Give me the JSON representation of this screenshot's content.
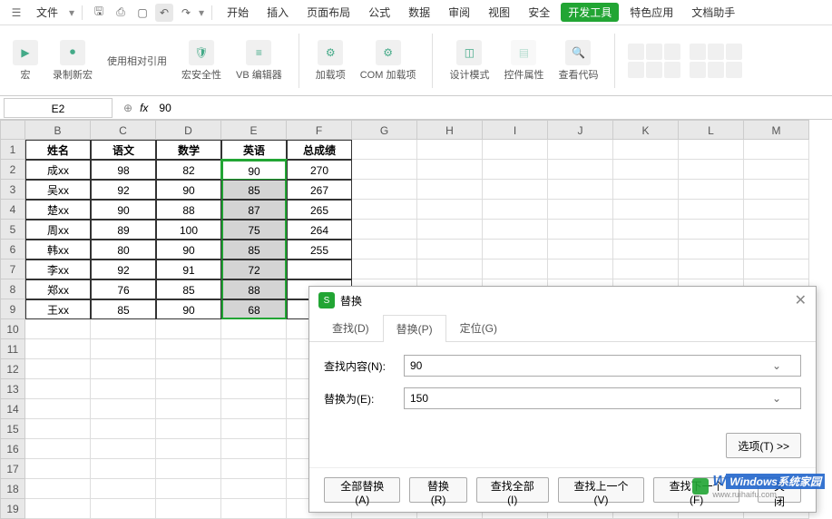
{
  "menu": {
    "file": "文件",
    "tabs": [
      "开始",
      "插入",
      "页面布局",
      "公式",
      "数据",
      "审阅",
      "视图",
      "安全"
    ],
    "dev": "开发工具",
    "extra": [
      "特色应用",
      "文档助手"
    ]
  },
  "ribbon": {
    "macro": "宏",
    "record": "录制新宏",
    "relative": "使用相对引用",
    "security": "宏安全性",
    "vb": "VB 编辑器",
    "addin": "加载项",
    "com": "COM 加载项",
    "design": "设计模式",
    "props": "控件属性",
    "viewcode": "查看代码"
  },
  "namebox": "E2",
  "formula": "90",
  "cols": [
    "B",
    "C",
    "D",
    "E",
    "F",
    "G",
    "H",
    "I",
    "J",
    "K",
    "L",
    "M"
  ],
  "headers": [
    "姓名",
    "语文",
    "数学",
    "英语",
    "总成绩"
  ],
  "rows": [
    [
      "成xx",
      "98",
      "82",
      "90",
      "270"
    ],
    [
      "吴xx",
      "92",
      "90",
      "85",
      "267"
    ],
    [
      "楚xx",
      "90",
      "88",
      "87",
      "265"
    ],
    [
      "周xx",
      "89",
      "100",
      "75",
      "264"
    ],
    [
      "韩xx",
      "80",
      "90",
      "85",
      "255"
    ],
    [
      "李xx",
      "92",
      "91",
      "72",
      ""
    ],
    [
      "郑xx",
      "76",
      "85",
      "88",
      ""
    ],
    [
      "王xx",
      "85",
      "90",
      "68",
      ""
    ]
  ],
  "dialog": {
    "title": "替换",
    "tabs": {
      "find": "查找(D)",
      "replace": "替换(P)",
      "goto": "定位(G)"
    },
    "findLabel": "查找内容(N):",
    "findValue": "90",
    "replaceLabel": "替换为(E):",
    "replaceValue": "150",
    "options": "选项(T) >>",
    "btns": {
      "all": "全部替换(A)",
      "replace": "替换(R)",
      "findall": "查找全部(I)",
      "prev": "查找上一个(V)",
      "next": "查找下一个(F)",
      "close": "关闭"
    }
  },
  "watermark": {
    "brand": "Windows",
    "suffix": "系统家园",
    "url": "www.ruihaifu.com"
  }
}
